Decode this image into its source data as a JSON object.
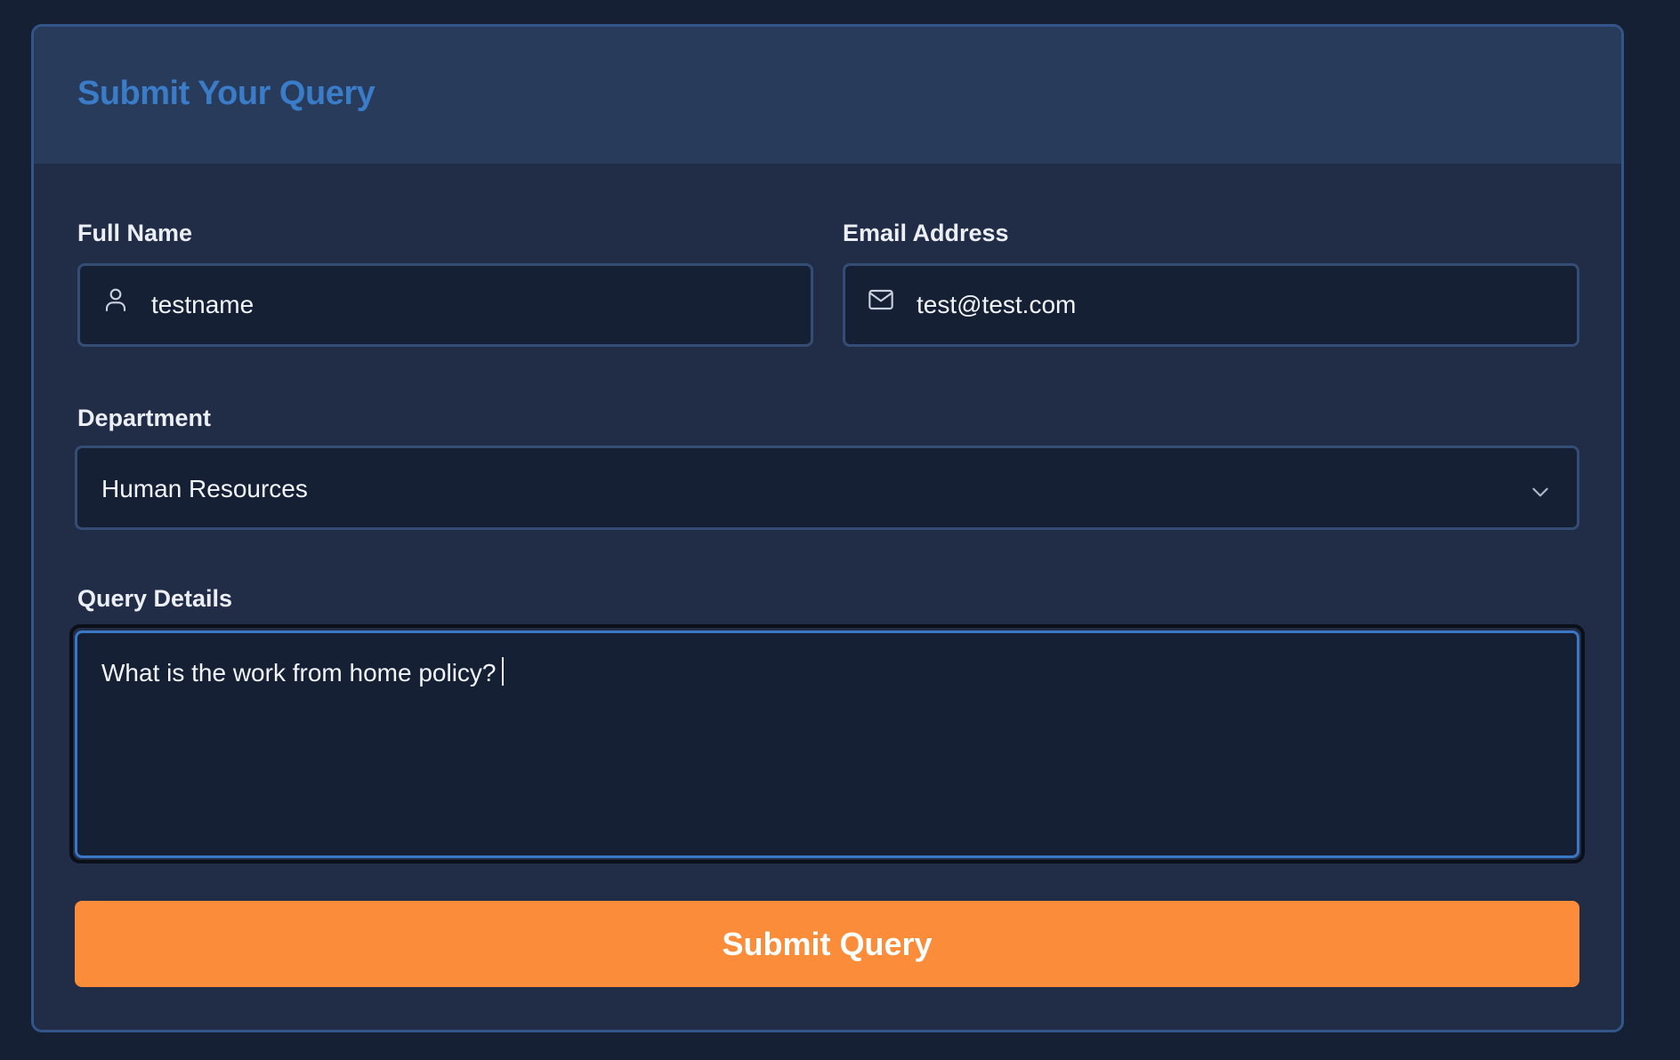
{
  "form": {
    "title": "Submit Your Query",
    "full_name": {
      "label": "Full Name",
      "value": "testname",
      "icon": "user-icon"
    },
    "email": {
      "label": "Email Address",
      "value": "test@test.com",
      "icon": "mail-icon"
    },
    "department": {
      "label": "Department",
      "selected": "Human Resources",
      "icon": "chevron-down-icon"
    },
    "query_details": {
      "label": "Query Details",
      "value": "What is the work from home policy?"
    },
    "submit_label": "Submit Query"
  },
  "colors": {
    "page_background": "#162035",
    "card_background": "#212c47",
    "header_background": "#283b5a",
    "title_accent": "#3a7cc8",
    "focus_border": "#3a77c4",
    "submit_button": "#fb8c3a"
  }
}
